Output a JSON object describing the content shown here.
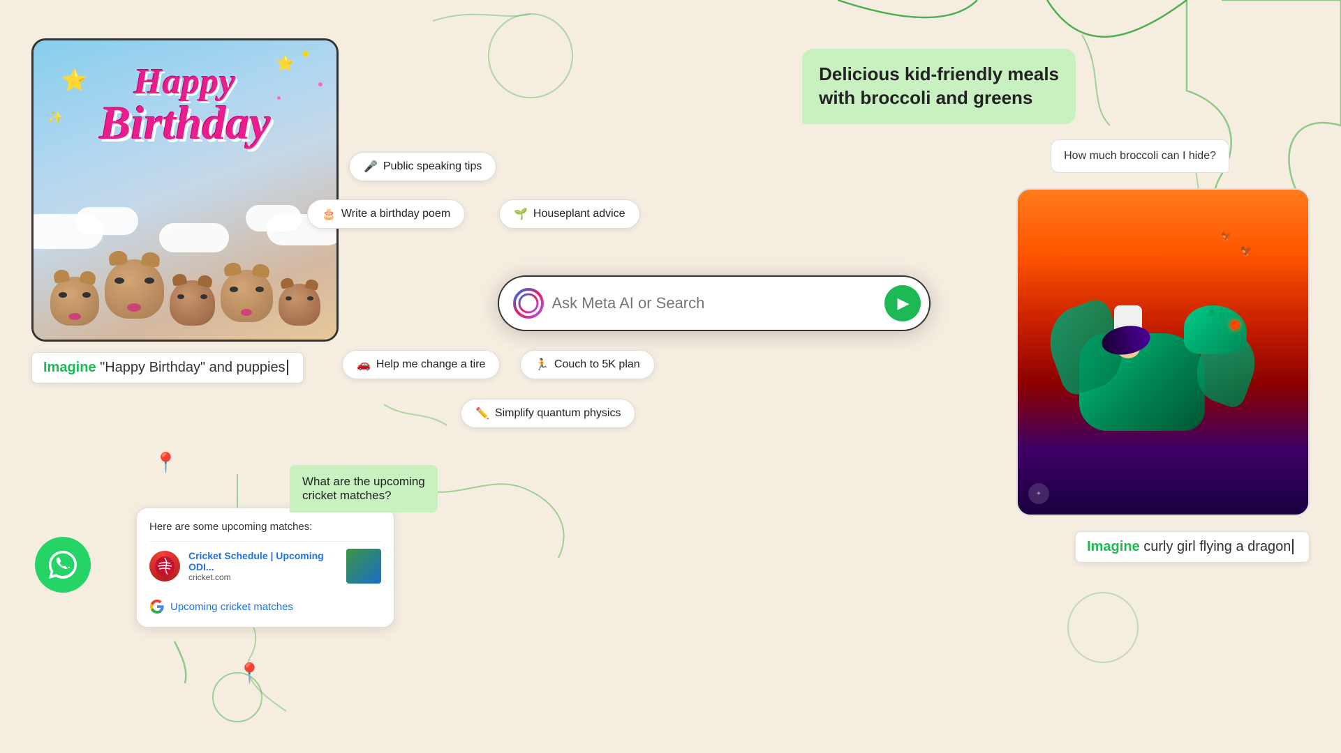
{
  "background_color": "#f5ede0",
  "accent_green": "#1db954",
  "search": {
    "placeholder": "Ask Meta AI or Search",
    "submit_label": "Send"
  },
  "chips": [
    {
      "id": "public-speaking",
      "icon": "🎤",
      "label": "Public speaking tips"
    },
    {
      "id": "birthday-poem",
      "icon": "🎂",
      "label": "Write a birthday poem"
    },
    {
      "id": "houseplant",
      "icon": "🌱",
      "label": "Houseplant advice"
    },
    {
      "id": "change-tire",
      "icon": "🚗",
      "label": "Help me change a tire"
    },
    {
      "id": "couch-5k",
      "icon": "🏃",
      "label": "Couch to 5K plan"
    },
    {
      "id": "quantum",
      "icon": "✏️",
      "label": "Simplify quantum physics"
    }
  ],
  "green_bubble": {
    "text": "Delicious kid-friendly meals\nwith broccoli and greens"
  },
  "white_bubble": {
    "text": "How much broccoli can I hide?"
  },
  "birthday_imagine": {
    "keyword": "Imagine",
    "rest": " \"Happy Birthday\" and puppies"
  },
  "dragon_imagine": {
    "keyword": "Imagine",
    "rest": " curly girl flying a dragon"
  },
  "cricket_bubble": {
    "text": "What are the upcoming\ncricket matches?"
  },
  "cricket_result": {
    "intro": "Here are some upcoming matches:",
    "item": {
      "title": "Cricket Schedule | Upcoming ODI...",
      "url": "cricket.com"
    },
    "google_link": "Upcoming cricket matches"
  }
}
